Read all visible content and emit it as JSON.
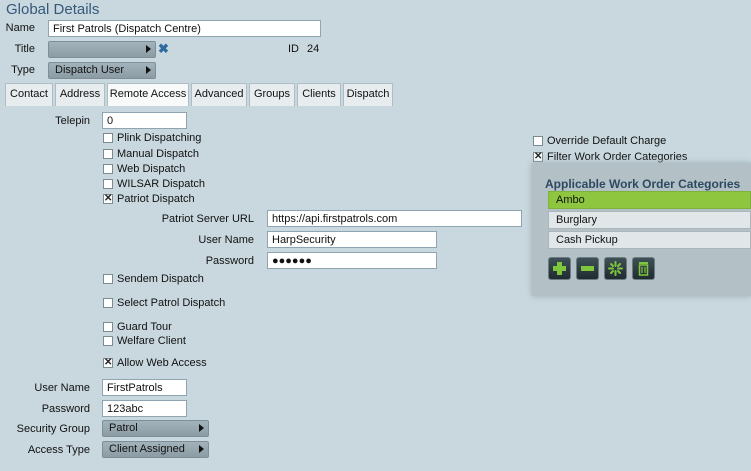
{
  "title": "Global Details",
  "header": {
    "name_label": "Name",
    "name_value": "First Patrols (Dispatch Centre)",
    "title_label": "Title",
    "title_value": "",
    "id_label": "ID",
    "id_value": "24",
    "type_label": "Type",
    "type_value": "Dispatch User"
  },
  "tabs": [
    {
      "label": "Contact"
    },
    {
      "label": "Address"
    },
    {
      "label": "Remote Access",
      "active": true
    },
    {
      "label": "Advanced"
    },
    {
      "label": "Groups"
    },
    {
      "label": "Clients"
    },
    {
      "label": "Dispatch"
    }
  ],
  "remote": {
    "telepin_label": "Telepin",
    "telepin_value": "0",
    "plink": {
      "label": "Plink Dispatching",
      "checked": false
    },
    "manual": {
      "label": "Manual Dispatch",
      "checked": false
    },
    "web": {
      "label": "Web Dispatch",
      "checked": false
    },
    "wilsar": {
      "label": "WILSAR Dispatch",
      "checked": false
    },
    "patriot": {
      "label": "Patriot Dispatch",
      "checked": true
    },
    "patriot_url_label": "Patriot Server URL",
    "patriot_url_value": "https://api.firstpatrols.com",
    "patriot_user_label": "User Name",
    "patriot_user_value": "HarpSecurity",
    "patriot_pass_label": "Password",
    "patriot_pass_value": "●●●●●●",
    "sendem": {
      "label": "Sendem Dispatch",
      "checked": false
    },
    "select_patrol": {
      "label": "Select Patrol Dispatch",
      "checked": false
    },
    "guard_tour": {
      "label": "Guard Tour",
      "checked": false
    },
    "welfare": {
      "label": "Welfare Client",
      "checked": false
    },
    "allow_web": {
      "label": "Allow Web Access",
      "checked": true
    },
    "user_label": "User Name",
    "user_value": "FirstPatrols",
    "pass_label": "Password",
    "pass_value": "123abc",
    "security_group_label": "Security Group",
    "security_group_value": "Patrol",
    "access_type_label": "Access Type",
    "access_type_value": "Client Assigned"
  },
  "right": {
    "override": {
      "label": "Override Default Charge",
      "checked": false
    },
    "filter": {
      "label": "Filter Work Order Categories",
      "checked": true
    }
  },
  "categories": {
    "title": "Applicable Work Order Categories",
    "items": [
      {
        "label": "Ambo",
        "selected": true
      },
      {
        "label": "Burglary",
        "selected": false
      },
      {
        "label": "Cash Pickup",
        "selected": false
      }
    ],
    "buttons": [
      "plus-icon",
      "minus-icon",
      "sparkle-icon",
      "trash-icon"
    ]
  },
  "colors": {
    "background": "#c9d8df",
    "title": "#36597a",
    "selected_item": "#8ec63f"
  }
}
